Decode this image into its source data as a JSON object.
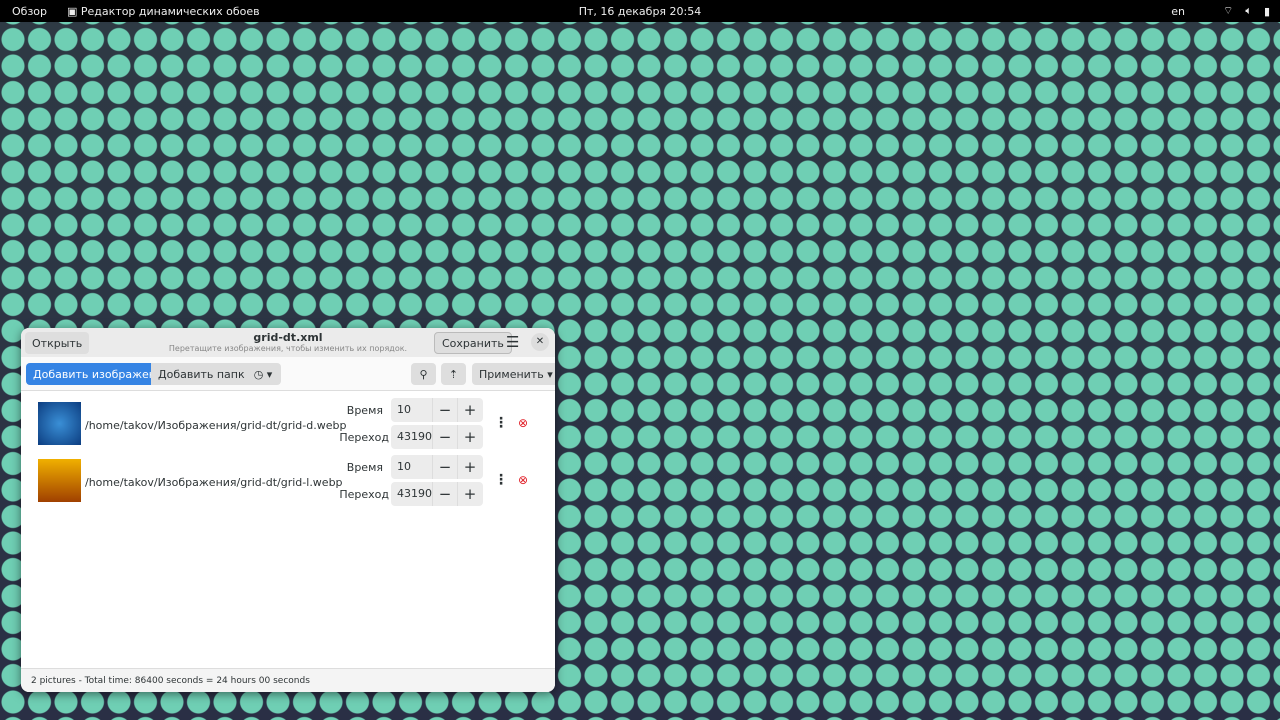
{
  "topbar": {
    "overview": "Обзор",
    "app": "Редактор динамических обоев",
    "datetime": "Пт, 16 декабря  20:54",
    "lang": "en"
  },
  "window": {
    "open": "Открыть",
    "title": "grid-dt.xml",
    "subtitle": "Перетащите изображения, чтобы изменить их порядок.",
    "save": "Сохранить",
    "add_images": "Добавить изображения",
    "add_folder": "Добавить папку",
    "apply": "Применить",
    "items": [
      {
        "path": "/home/takov/Изображения/grid-dt/grid-d.webp",
        "time_label": "Время",
        "time": "10",
        "trans_label": "Переход",
        "trans": "43190",
        "thumb": "blue"
      },
      {
        "path": "/home/takov/Изображения/grid-dt/grid-l.webp",
        "time_label": "Время",
        "time": "10",
        "trans_label": "Переход",
        "trans": "43190",
        "thumb": "orange"
      }
    ],
    "status": "2 pictures - Total time: 86400 seconds = 24 hours 00 seconds"
  },
  "colors": {
    "accent": "#3584e4",
    "delete": "#e01b24"
  }
}
